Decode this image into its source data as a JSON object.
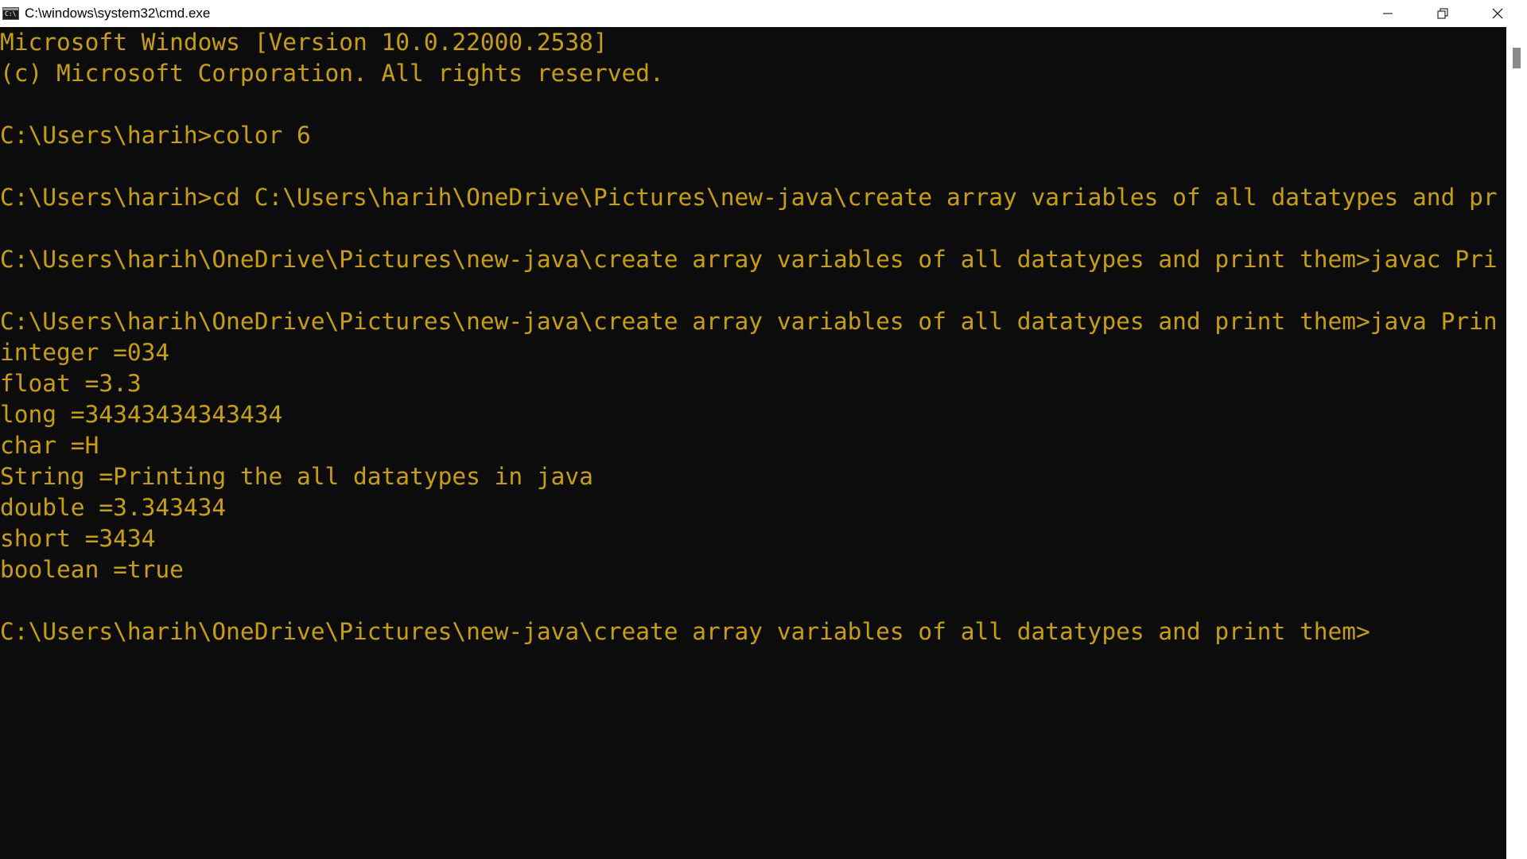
{
  "window": {
    "title": "C:\\windows\\system32\\cmd.exe",
    "icon": "cmd-icon",
    "icon_text": "C:\\",
    "controls": {
      "minimize_icon": "minimize-icon",
      "maximize_icon": "restore-icon",
      "close_icon": "close-icon"
    }
  },
  "console": {
    "text_color": "#c8a000",
    "background_color": "#0c0c0c",
    "lines": [
      "Microsoft Windows [Version 10.0.22000.2538]",
      "(c) Microsoft Corporation. All rights reserved.",
      "",
      "C:\\Users\\harih>color 6",
      "",
      "C:\\Users\\harih>cd C:\\Users\\harih\\OneDrive\\Pictures\\new-java\\create array variables of all datatypes and pr",
      "",
      "C:\\Users\\harih\\OneDrive\\Pictures\\new-java\\create array variables of all datatypes and print them>javac Pri",
      "",
      "C:\\Users\\harih\\OneDrive\\Pictures\\new-java\\create array variables of all datatypes and print them>java Prin",
      "integer =034",
      "float =3.3",
      "long =34343434343434",
      "char =H",
      "String =Printing the all datatypes in java",
      "double =3.343434",
      "short =3434",
      "boolean =true",
      "",
      "C:\\Users\\harih\\OneDrive\\Pictures\\new-java\\create array variables of all datatypes and print them>"
    ]
  }
}
